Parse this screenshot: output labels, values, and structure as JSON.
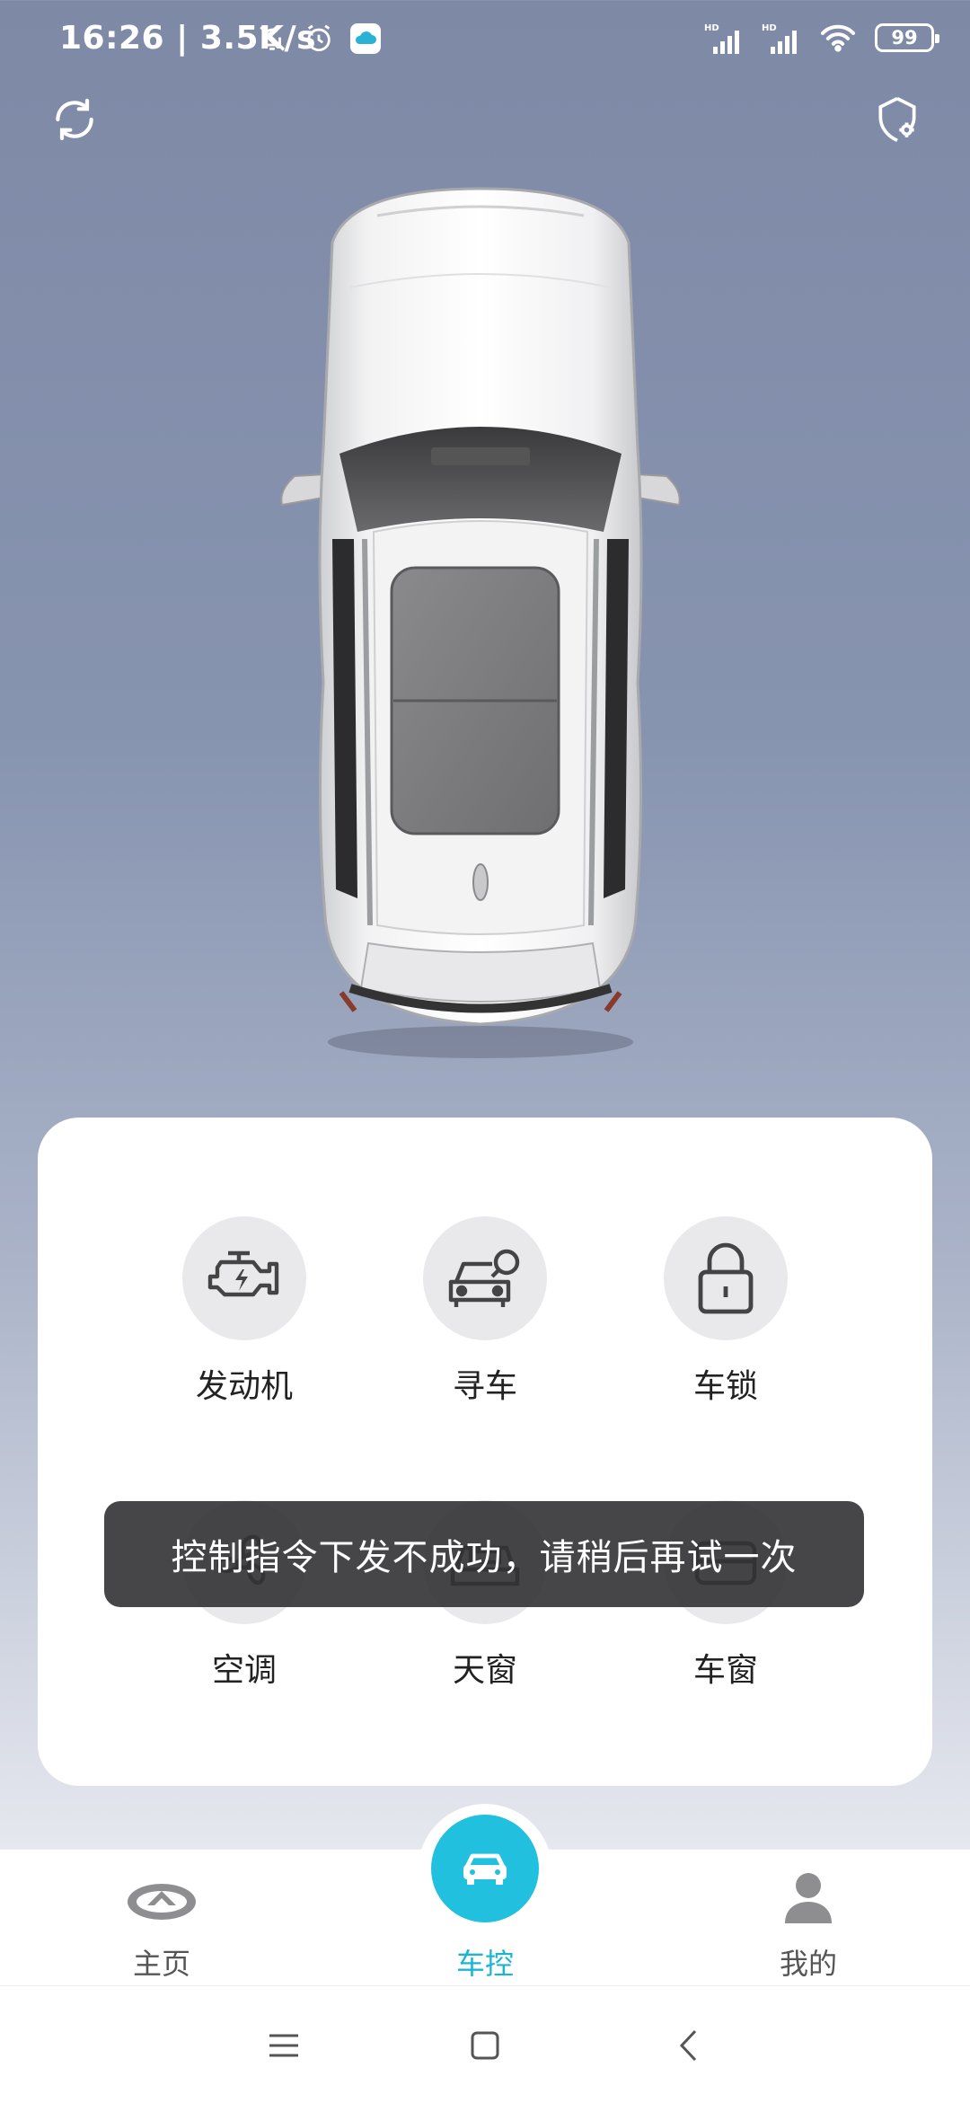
{
  "status_bar": {
    "time": "16:26",
    "speed": "3.5K/s",
    "battery": "99",
    "icons": [
      "notifications-off-icon",
      "alarm-icon",
      "cloud-app-icon",
      "signal-hd-icon",
      "signal-hd-icon",
      "wifi-icon",
      "battery-icon"
    ]
  },
  "top_actions": {
    "left_icon": "refresh-icon",
    "right_icon": "settings-shield-icon"
  },
  "controls": [
    {
      "label": "发动机",
      "icon": "engine-icon"
    },
    {
      "label": "寻车",
      "icon": "find-car-icon"
    },
    {
      "label": "车锁",
      "icon": "lock-icon"
    },
    {
      "label": "空调",
      "icon": "air-conditioning-icon"
    },
    {
      "label": "天窗",
      "icon": "sunroof-icon"
    },
    {
      "label": "车窗",
      "icon": "window-icon"
    }
  ],
  "toast": {
    "message": "控制指令下发不成功，请稍后再试一次"
  },
  "bottom_nav": {
    "items": [
      {
        "label": "主页",
        "icon": "brand-logo-icon"
      },
      {
        "label": "车控",
        "icon": "car-icon",
        "active": true
      },
      {
        "label": "我的",
        "icon": "user-icon"
      }
    ],
    "active_color": "#1bb5d3"
  },
  "system_nav": [
    "menu-icon",
    "home-icon",
    "back-icon"
  ]
}
